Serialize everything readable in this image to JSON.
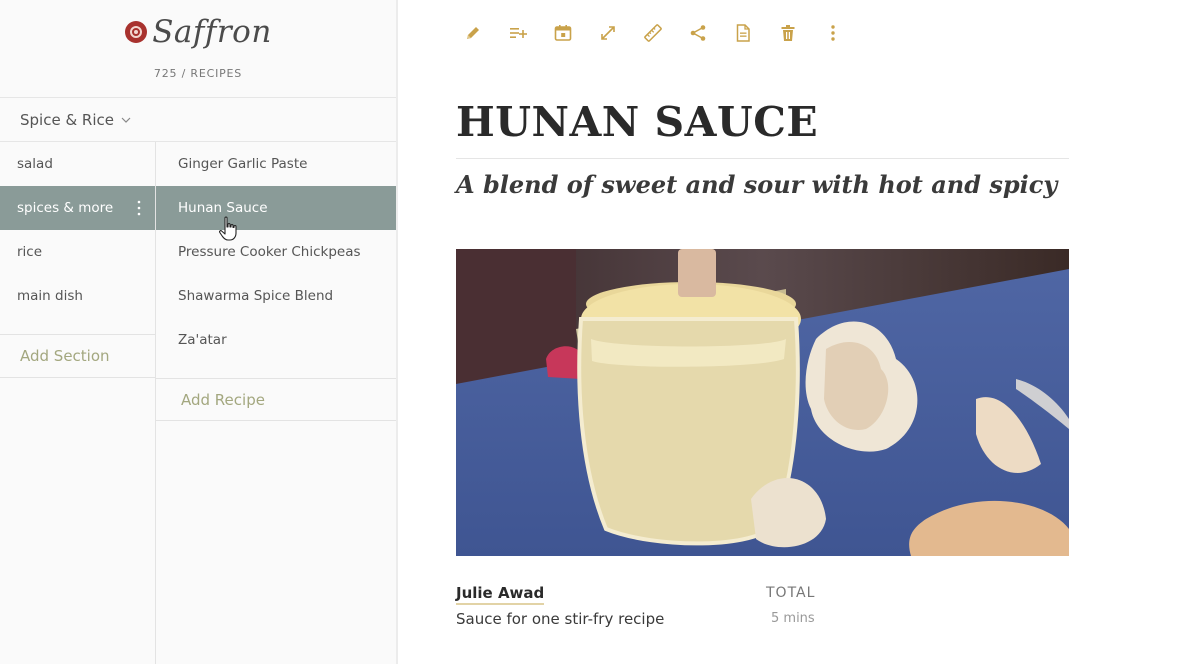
{
  "app": {
    "name": "Saffron",
    "recipe_count": "725 / RECIPES"
  },
  "category": {
    "selected": "Spice & Rice"
  },
  "sections": [
    {
      "label": "salad"
    },
    {
      "label": "spices & more",
      "active": true
    },
    {
      "label": "rice"
    },
    {
      "label": "main dish"
    }
  ],
  "add_section_label": "Add Section",
  "recipes": [
    {
      "label": "Ginger Garlic Paste"
    },
    {
      "label": "Hunan Sauce",
      "active": true
    },
    {
      "label": "Pressure Cooker Chickpeas"
    },
    {
      "label": "Shawarma Spice Blend"
    },
    {
      "label": "Za'atar"
    }
  ],
  "add_recipe_label": "Add Recipe",
  "toolbar": {
    "icons": [
      "edit-icon",
      "add-to-list-icon",
      "calendar-icon",
      "expand-icon",
      "ruler-icon",
      "share-icon",
      "document-icon",
      "trash-icon",
      "more-vertical-icon"
    ]
  },
  "recipe": {
    "title": "HUNAN SAUCE",
    "subtitle": "A blend of sweet and sour with hot and spicy",
    "author": "Julie Awad",
    "description": "Sauce for one stir-fry recipe",
    "total_label": "TOTAL",
    "total_time": "5 mins"
  },
  "colors": {
    "accent": "#c9a24a",
    "active_row": "#8a9b98",
    "add_link": "#a3a77f",
    "logo_red": "#a8322e"
  }
}
